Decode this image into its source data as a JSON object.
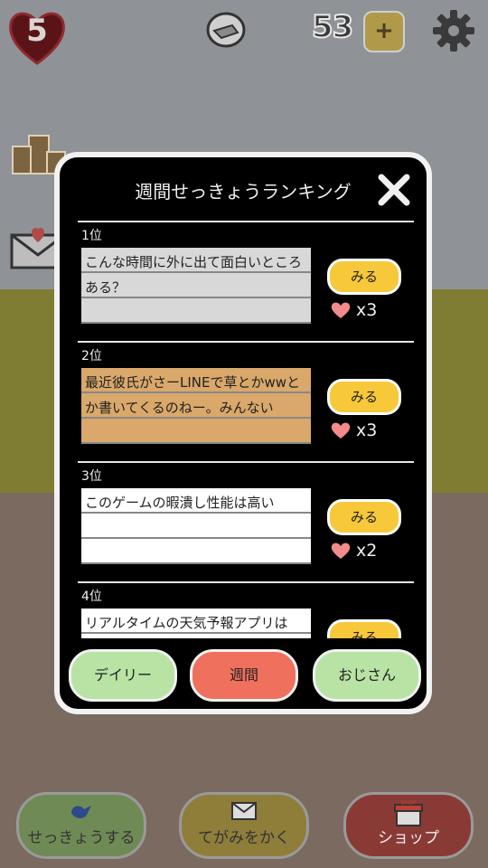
{
  "hud": {
    "hearts": "5",
    "coins": "53",
    "plus_label": "+"
  },
  "bottom_bar": {
    "sekkyou_label": "せっきょうする",
    "tegami_label": "てがみをかく",
    "shop_label": "ショップ",
    "shop_sign": "SHOP"
  },
  "modal": {
    "title": "週間せっきょうランキング",
    "rankings": [
      {
        "rank": "1位",
        "text": "こんな時間に外に出て面白いところある？",
        "view_label": "みる",
        "likes": "x3"
      },
      {
        "rank": "2位",
        "text": "最近彼氏がさーLINEで草とかwwとか書いてくるのねー。みんない",
        "view_label": "みる",
        "likes": "x3"
      },
      {
        "rank": "3位",
        "text": "このゲームの暇潰し性能は高い",
        "view_label": "みる",
        "likes": "x2"
      },
      {
        "rank": "4位",
        "text": "リアルタイムの天気予報アプリは",
        "view_label": "みる",
        "likes": ""
      }
    ],
    "tabs": {
      "daily": "デイリー",
      "weekly": "週間",
      "ojisan": "おじさん"
    }
  },
  "colors": {
    "tab_active": "#f0705e",
    "tab_inactive": "#b8e3a4",
    "view_button": "#f7c83a",
    "like_heart": "#f28b8b"
  }
}
